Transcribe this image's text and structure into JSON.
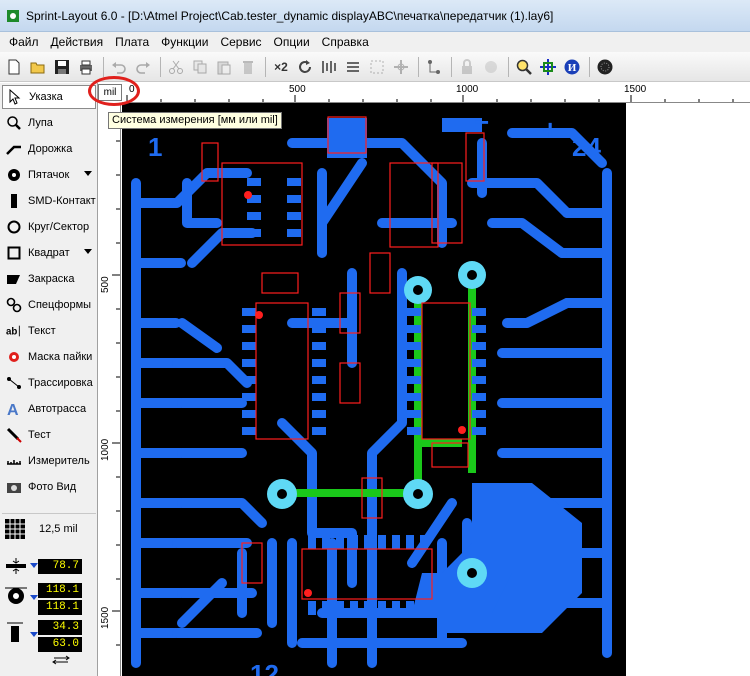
{
  "window": {
    "title": "Sprint-Layout 6.0 - [D:\\Atmel Project\\Cab.tester_dynamic displayABC\\печатка\\передатчик (1).lay6]"
  },
  "menu": [
    "Файл",
    "Действия",
    "Плата",
    "Функции",
    "Сервис",
    "Опции",
    "Справка"
  ],
  "toolbar": {
    "mirror_label": "×2",
    "icons": [
      "new-icon",
      "open-icon",
      "save-icon",
      "print-icon",
      "undo-icon",
      "redo-icon",
      "cut-icon",
      "copy-icon",
      "paste-icon",
      "delete-icon",
      "rotate-icon",
      "align-icon",
      "zoom-icon",
      "crosshair-icon",
      "info-icon",
      "component-icon"
    ]
  },
  "tools": [
    {
      "label": "Указка",
      "icon": "pointer-icon"
    },
    {
      "label": "Лупа",
      "icon": "magnifier-icon"
    },
    {
      "label": "Дорожка",
      "icon": "track-icon"
    },
    {
      "label": "Пятачок",
      "icon": "pad-icon"
    },
    {
      "label": "SMD-Контакт",
      "icon": "smd-icon"
    },
    {
      "label": "Круг/Сектор",
      "icon": "circle-icon"
    },
    {
      "label": "Квадрат",
      "icon": "square-icon"
    },
    {
      "label": "Закраска",
      "icon": "fill-icon"
    },
    {
      "label": "Спецформы",
      "icon": "special-shapes-icon"
    },
    {
      "label": "Текст",
      "icon": "text-icon"
    },
    {
      "label": "Маска пайки",
      "icon": "solder-mask-icon"
    },
    {
      "label": "Трассировка",
      "icon": "routing-icon"
    },
    {
      "label": "Автотрасса",
      "icon": "autoroute-icon"
    },
    {
      "label": "Тест",
      "icon": "test-icon"
    },
    {
      "label": "Измеритель",
      "icon": "measure-icon"
    },
    {
      "label": "Фото Вид",
      "icon": "photo-icon"
    }
  ],
  "grid": {
    "value": "12,5 mil"
  },
  "params": {
    "track_width": "78.7",
    "pad_outer": "118.1",
    "pad_inner": "118.1",
    "smd_width": "34.3",
    "smd_height": "63.0"
  },
  "units": {
    "button": "mil",
    "tooltip": "Система измерения [мм или mil]"
  },
  "ruler": {
    "top": [
      "0",
      "500",
      "1000",
      "1500"
    ],
    "left": [
      "500",
      "1000",
      "1500"
    ]
  },
  "pcb": {
    "labels": {
      "corner_tl": "1",
      "corner_tr": "24",
      "plus": "+",
      "minus": "−",
      "bottom": "12"
    },
    "colors": {
      "copper": "#1f6bf0",
      "board": "#000000",
      "silk": "#ff1f1f",
      "via": "#5fd9f5",
      "green": "#1ac81a"
    }
  }
}
